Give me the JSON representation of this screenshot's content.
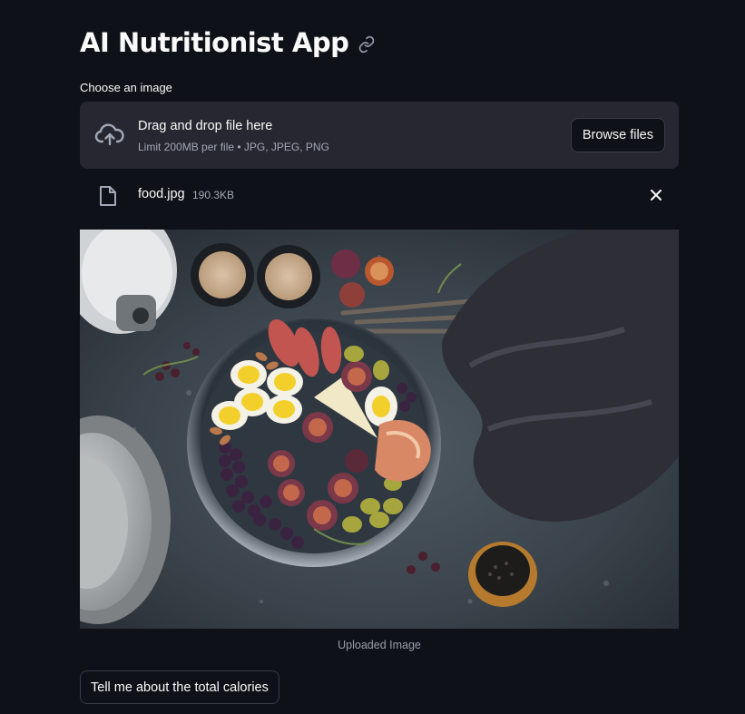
{
  "app": {
    "title": "AI Nutritionist App",
    "anchor_icon": "link-icon"
  },
  "uploader": {
    "label": "Choose an image",
    "icon": "cloud-upload-icon",
    "drag_text": "Drag and drop file here",
    "limit_text": "Limit 200MB per file • JPG, JPEG, PNG",
    "browse_label": "Browse files"
  },
  "uploaded_file": {
    "icon": "file-icon",
    "name": "food.jpg",
    "size": "190.3KB",
    "remove_icon": "close-icon"
  },
  "image": {
    "caption": "Uploaded Image"
  },
  "actions": {
    "calories_button": "Tell me about the total calories"
  },
  "colors": {
    "background": "#0e1117",
    "panel": "#262730",
    "text": "#fafafa",
    "muted_text": "#a3a8b8",
    "border": "#3b3d47"
  }
}
